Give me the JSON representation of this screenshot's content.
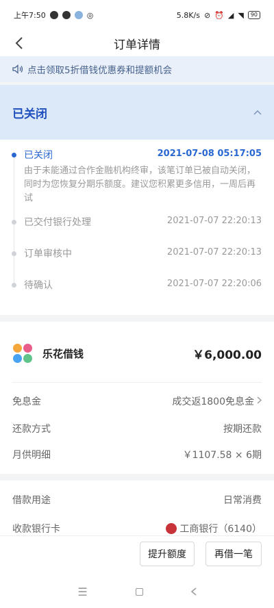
{
  "status_bar": {
    "time": "上午7:50",
    "net_speed": "5.8K/s",
    "battery": "90"
  },
  "nav": {
    "title": "订单详情"
  },
  "notice": {
    "text": "点击领取5折借钱优惠券和提额机会"
  },
  "order_status": {
    "label": "已关闭"
  },
  "timeline": [
    {
      "name": "已关闭",
      "time": "2021-07-08 05:17:05",
      "desc": "由于未能通过合作金融机构终审，该笔订单已被自动关闭，同时为您恢复分期乐额度。建议您积累更多信用，一周后再试"
    },
    {
      "name": "已交付银行处理",
      "time": "2021-07-07 22:20:13"
    },
    {
      "name": "订单审核中",
      "time": "2021-07-07 22:20:13"
    },
    {
      "name": "待确认",
      "time": "2021-07-07 22:20:06"
    }
  ],
  "product": {
    "name": "乐花借钱",
    "amount": "￥6,000.00",
    "logo_colors": [
      "#f4a63b",
      "#e85d8a",
      "#4aa3f0",
      "#5fc38a"
    ]
  },
  "details": [
    {
      "label": "免息金",
      "value": "成交返1800免息金"
    },
    {
      "label": "还款方式",
      "value": "按期还款"
    },
    {
      "label": "月供明细",
      "value": "￥1107.58 × 6期"
    }
  ],
  "details2": [
    {
      "label": "借款用途",
      "value": "日常消费"
    },
    {
      "label": "收款银行卡",
      "value": "工商银行（6140）"
    }
  ],
  "actions": {
    "raise_limit": "提升额度",
    "borrow_again": "再借一笔"
  },
  "colors": {
    "accent": "#2a68d1",
    "status_bg": "#dce9f9",
    "notice_bg": "#e9f0fa"
  }
}
